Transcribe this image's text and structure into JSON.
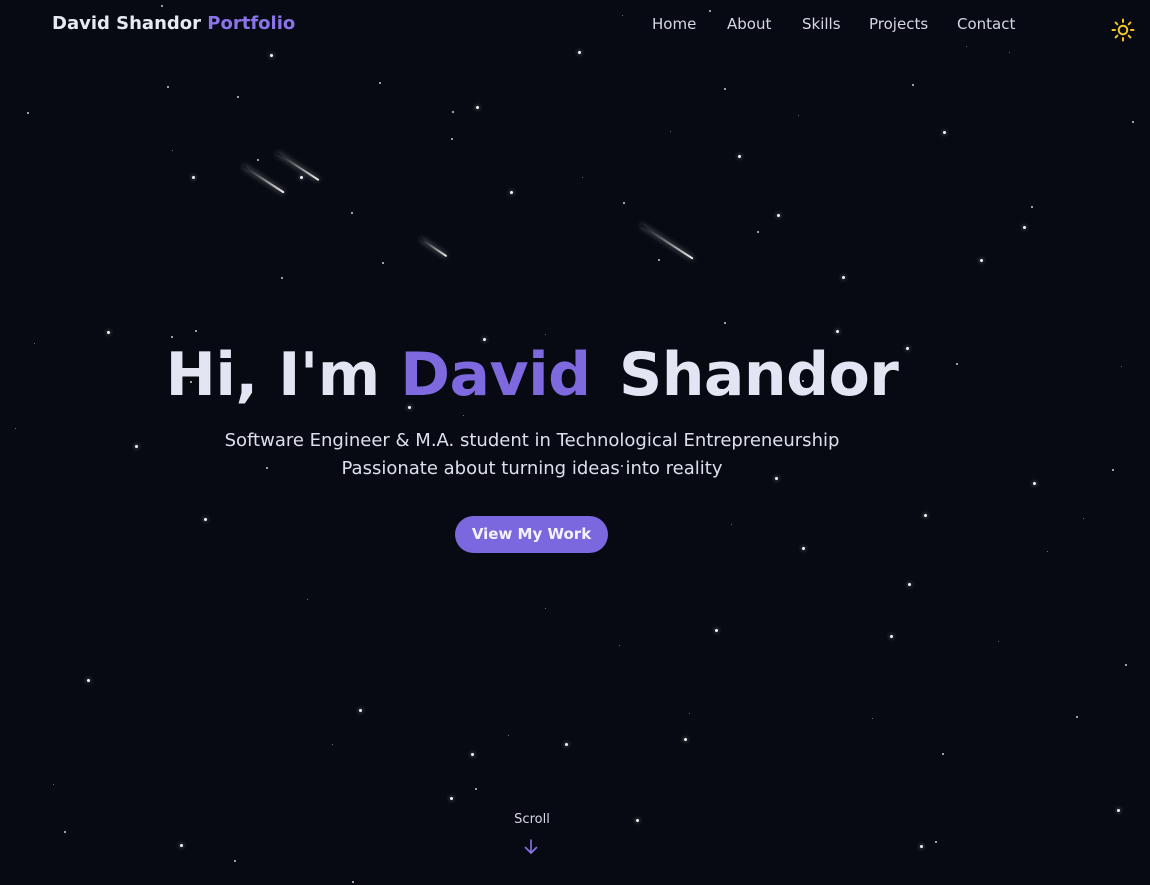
{
  "nav": {
    "brand_name": "David Shandor",
    "brand_accent": "Portfolio",
    "links": [
      "Home",
      "About",
      "Skills",
      "Projects",
      "Contact"
    ],
    "theme_icon": "sun-icon"
  },
  "hero": {
    "greeting": "Hi, I'm",
    "first_name": "David",
    "last_name": "Shandor",
    "subtitle_line1": "Software Engineer & M.A. student in Technological Entrepreneurship",
    "subtitle_line2": "Passionate about turning ideas into reality",
    "cta_label": "View My Work"
  },
  "scroll": {
    "label": "Scroll",
    "icon": "arrow-down-icon"
  },
  "colors": {
    "background": "#070a12",
    "accent": "#7b68de",
    "sun": "#f3c623"
  }
}
